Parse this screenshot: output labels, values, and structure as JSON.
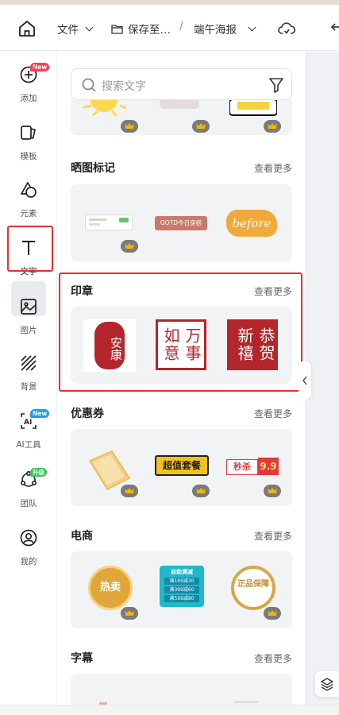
{
  "topbar": {
    "file_label": "文件",
    "save_label": "保存至…",
    "separator": "/",
    "project_name": "端午海报"
  },
  "sidebar": {
    "items": [
      {
        "label": "添加",
        "badge": "New"
      },
      {
        "label": "模板"
      },
      {
        "label": "元素"
      },
      {
        "label": "文字"
      },
      {
        "label": "图片"
      },
      {
        "label": "背景"
      },
      {
        "label": "AI工具",
        "badge": "New"
      },
      {
        "label": "团队",
        "badge": "升级"
      },
      {
        "label": "我的"
      }
    ]
  },
  "search": {
    "placeholder": "搜索文字"
  },
  "sections": [
    {
      "title": "晒图标记",
      "more": "查看更多"
    },
    {
      "title": "印章",
      "more": "查看更多"
    },
    {
      "title": "优惠券",
      "more": "查看更多"
    },
    {
      "title": "电商",
      "more": "查看更多"
    },
    {
      "title": "字幕",
      "more": "查看更多"
    }
  ],
  "thumbs": {
    "ootd": "OOTD今日穿搭",
    "before": "before",
    "stamp1": "安康",
    "stamp2": "万事如意",
    "stamp3": "恭贺新禧",
    "chaozhi": "超值套餐",
    "miaosha": "秒杀",
    "price": "9.9",
    "hot": "热卖",
    "zhengpin": "正品保障",
    "coupon_title": "自助满减",
    "coupon_lines": [
      "满199减30",
      "满399减60",
      "满599减80"
    ]
  },
  "colors": {
    "accent_red": "#e53030",
    "stamp_red": "#b3262b",
    "crown_bg": "#7a7a7a",
    "gold": "#d4a439"
  }
}
